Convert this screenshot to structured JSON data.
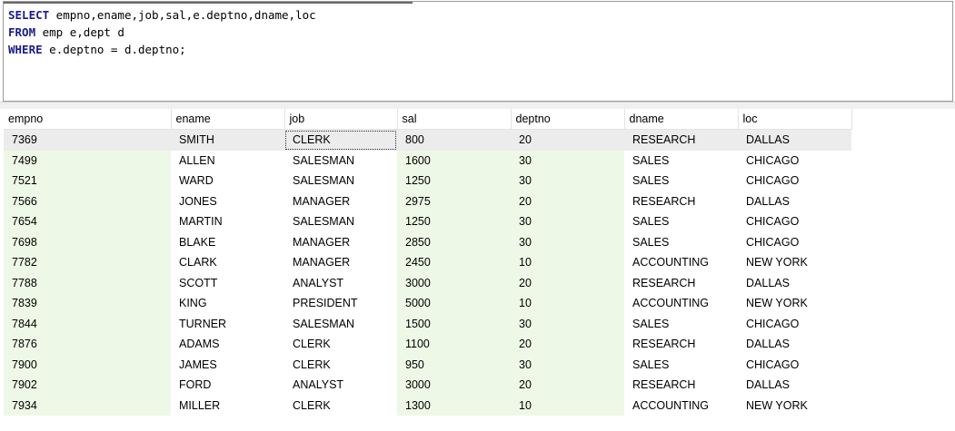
{
  "editor": {
    "lines": [
      {
        "keyword": "SELECT",
        "rest": " empno,ename,job,sal,e.deptno,dname,loc"
      },
      {
        "keyword": "FROM",
        "rest": " emp e,dept d"
      },
      {
        "keyword": "WHERE",
        "rest": " e.deptno = d.deptno;"
      }
    ]
  },
  "grid": {
    "columns": [
      "empno",
      "ename",
      "job",
      "sal",
      "deptno",
      "dname",
      "loc"
    ],
    "rows": [
      [
        "7369",
        "SMITH",
        "CLERK",
        "800",
        "20",
        "RESEARCH",
        "DALLAS"
      ],
      [
        "7499",
        "ALLEN",
        "SALESMAN",
        "1600",
        "30",
        "SALES",
        "CHICAGO"
      ],
      [
        "7521",
        "WARD",
        "SALESMAN",
        "1250",
        "30",
        "SALES",
        "CHICAGO"
      ],
      [
        "7566",
        "JONES",
        "MANAGER",
        "2975",
        "20",
        "RESEARCH",
        "DALLAS"
      ],
      [
        "7654",
        "MARTIN",
        "SALESMAN",
        "1250",
        "30",
        "SALES",
        "CHICAGO"
      ],
      [
        "7698",
        "BLAKE",
        "MANAGER",
        "2850",
        "30",
        "SALES",
        "CHICAGO"
      ],
      [
        "7782",
        "CLARK",
        "MANAGER",
        "2450",
        "10",
        "ACCOUNTING",
        "NEW YORK"
      ],
      [
        "7788",
        "SCOTT",
        "ANALYST",
        "3000",
        "20",
        "RESEARCH",
        "DALLAS"
      ],
      [
        "7839",
        "KING",
        "PRESIDENT",
        "5000",
        "10",
        "ACCOUNTING",
        "NEW YORK"
      ],
      [
        "7844",
        "TURNER",
        "SALESMAN",
        "1500",
        "30",
        "SALES",
        "CHICAGO"
      ],
      [
        "7876",
        "ADAMS",
        "CLERK",
        "1100",
        "20",
        "RESEARCH",
        "DALLAS"
      ],
      [
        "7900",
        "JAMES",
        "CLERK",
        "950",
        "30",
        "SALES",
        "CHICAGO"
      ],
      [
        "7902",
        "FORD",
        "ANALYST",
        "3000",
        "20",
        "RESEARCH",
        "DALLAS"
      ],
      [
        "7934",
        "MILLER",
        "CLERK",
        "1300",
        "10",
        "ACCOUNTING",
        "NEW YORK"
      ]
    ],
    "selected_row": 0,
    "focused_cell": [
      0,
      2
    ],
    "tinted_columns": [
      0,
      3,
      4
    ]
  },
  "colors": {
    "keyword": "#1a1a8c",
    "column_tint": "#eef8e6",
    "selected_row": "#ececec"
  }
}
